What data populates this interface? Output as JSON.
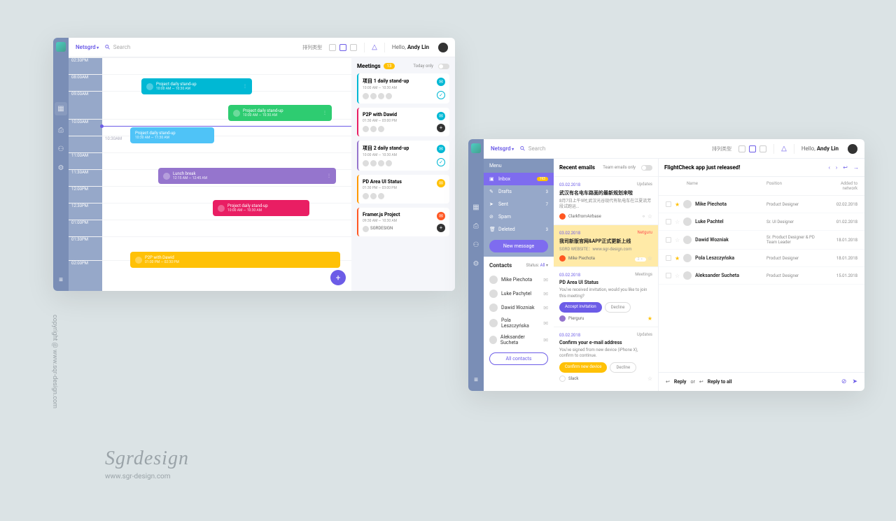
{
  "copyright": "copyright @ www.sqr-design.com",
  "brand": {
    "name": "Sgrdesign",
    "url": "www.sgr-design.com"
  },
  "s1": {
    "workspace": "Netsgrd",
    "search": "Search",
    "viewLabel": "排列类型",
    "greeting": "Hello, ",
    "user": "Andy Lin",
    "times": [
      "08:00AM",
      "09:00AM",
      "10:00AM",
      "10:30AM",
      "11:00AM",
      "11:30AM",
      "12:00PM",
      "12:30PM",
      "01:00PM",
      "01:30PM",
      "02:00PM",
      "02:30PM"
    ],
    "events": [
      {
        "title": "Project daily stand-up",
        "time": "10:00 AM — 10:30 AM"
      },
      {
        "title": "Project daily stand-up",
        "time": "10:00 AM — 10:30 AM"
      },
      {
        "title": "Project daily stand-up",
        "time": "10:30 AM — 11:30 AM"
      },
      {
        "title": "Lunch break",
        "time": "12:15 AM — 12:45 AM"
      },
      {
        "title": "Project daily stand-up",
        "time": "10:00 AM — 10:30 AM"
      },
      {
        "title": "P2P with Dawid",
        "time": "01:00 PM — 02:30 PM"
      }
    ],
    "sidebar": {
      "title": "Meetings",
      "count": "13",
      "today": "Today only",
      "cards": [
        {
          "title": "项目 1 daily stand-up",
          "time": "10:00 AM — 10:30 AM"
        },
        {
          "title": "P2P with Dawid",
          "time": "01:30 AM — 03:00 PM"
        },
        {
          "title": "项目 2 daily stand-up",
          "time": "10:00 AM — 10:30 AM"
        },
        {
          "title": "PD Area UI Status",
          "time": "01:30 PM — 03:00 PM"
        },
        {
          "title": "Framer.js Project",
          "time": "09:30 AM — 10:30 AM",
          "by": "SGRDESIGN"
        }
      ]
    }
  },
  "s2": {
    "workspace": "Netsgrd",
    "search": "Search",
    "viewLabel": "排列类型",
    "greeting": "Hello, ",
    "user": "Andy Lin",
    "menu": {
      "header": "Menu",
      "items": [
        {
          "label": "Inbox",
          "count": "193"
        },
        {
          "label": "Drafts",
          "count": "3"
        },
        {
          "label": "Sent",
          "count": "7"
        },
        {
          "label": "Spam"
        },
        {
          "label": "Deleted",
          "count": "3"
        }
      ],
      "newmsg": "New message"
    },
    "contacts": {
      "title": "Contacts",
      "status": "Status:",
      "all": "All",
      "allBtn": "All contacts",
      "rows": [
        "Mike Piechota",
        "Luke Pachytel",
        "Dawid Wozniak",
        "Pola Leszczyńska",
        "Aleksander Sucheta"
      ]
    },
    "emails": {
      "title": "Recent emails",
      "filter": "Team emails only",
      "cards": [
        {
          "date": "03.02.2018",
          "cat": "Updates",
          "title": "武汉有名电车路面的最新规划来啦",
          "desc": "8月7日上午9时,武汉光谷现代有轨电车在江夏流芳段试跑运…",
          "from": "ClarkfromAirbase"
        },
        {
          "date": "03.02.2018",
          "cat": "Netguru",
          "title": "我司新版官网&APP正式更新上线",
          "desc": "SGRD WEBSITE：www.sgr-design.com",
          "from": "Mike Piechota",
          "badge": "2"
        },
        {
          "date": "03.02.2018",
          "cat": "Meetings",
          "title": "PD Area UI Status",
          "desc": "You've received invitation, would you like to join this meeting?",
          "btn1": "Accept invitation",
          "btn2": "Decline",
          "from": "Pierguru"
        },
        {
          "date": "03.02.2018",
          "cat": "Updates",
          "title": "Confirm your e-mail address",
          "desc": "You've signed from new device (iPhone X), confirm to continue.",
          "btn1": "Confirm new device",
          "btn2": "Decline",
          "from": "Slack"
        }
      ]
    },
    "detail": {
      "title": "FlightCheck app just released!",
      "headers": [
        "Name",
        "Position",
        "Added to network"
      ],
      "rows": [
        {
          "name": "Mike Piechota",
          "pos": "Product Designer",
          "date": "02.02.2018"
        },
        {
          "name": "Luke Pachtel",
          "pos": "Sr. UI Designer",
          "date": "01.02.2018"
        },
        {
          "name": "Dawid Wozniak",
          "pos": "Sr. Product Designer & PD Team Leader",
          "date": "18.01.2018"
        },
        {
          "name": "Pola Leszczyńska",
          "pos": "Product Designer",
          "date": "18.01.2018"
        },
        {
          "name": "Aleksander Sucheta",
          "pos": "Product Designer",
          "date": "15.01.2018"
        }
      ],
      "reply": "Reply",
      "or": "or",
      "replyAll": "Reply to all"
    }
  }
}
